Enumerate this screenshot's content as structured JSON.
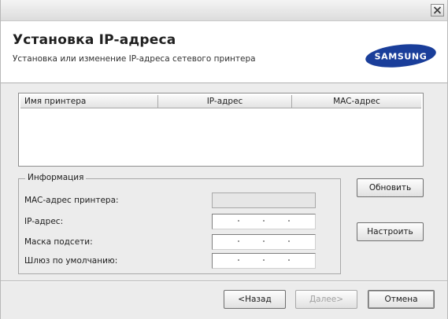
{
  "window": {
    "close_label": "✕"
  },
  "header": {
    "title": "Установка IP-адреса",
    "subtitle": "Установка или изменение IP-адреса сетевого принтера",
    "logo_text": "SAMSUNG"
  },
  "printer_list": {
    "columns": [
      "Имя принтера",
      "IP-адрес",
      "MAC-адрес"
    ],
    "rows": []
  },
  "info_group": {
    "title": "Информация",
    "fields": [
      {
        "label": "MAC-адрес принтера:",
        "value": "",
        "disabled": true
      },
      {
        "label": "IP-адрес:",
        "value": "",
        "disabled": false
      },
      {
        "label": "Маска подсети:",
        "value": "",
        "disabled": false
      },
      {
        "label": "Шлюз по умолчанию:",
        "value": "",
        "disabled": false
      }
    ]
  },
  "buttons": {
    "refresh": "Обновить",
    "configure": "Настроить",
    "back": "<Назад",
    "next": "Далее>",
    "cancel": "Отмена"
  },
  "colors": {
    "logo_blue": "#1a3e9a",
    "dialog_bg": "#ececec"
  }
}
